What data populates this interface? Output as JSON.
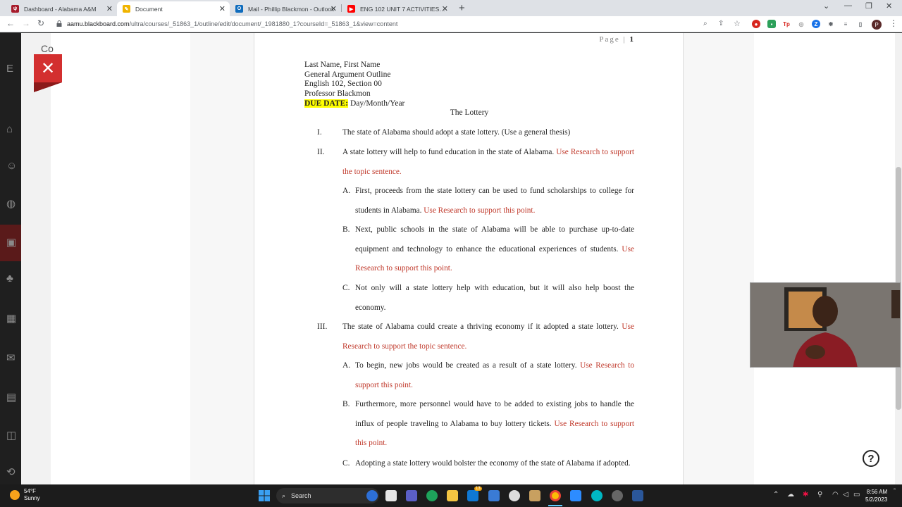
{
  "tabs": [
    {
      "label": "Dashboard - Alabama A&M",
      "color": "#a61b2b",
      "icon": "blackboard-favicon"
    },
    {
      "label": "Document",
      "color": "#f0b400",
      "icon": "document-favicon"
    },
    {
      "label": "Mail - Phillip Blackmon - Outlook",
      "color": "#0f6cbd",
      "icon": "outlook-favicon"
    },
    {
      "label": "ENG 102 UNIT 7 ACTIVITIES - Yo",
      "color": "#ff0000",
      "icon": "youtube-favicon"
    }
  ],
  "address": {
    "host": "aamu.blackboard.com",
    "path": "/ultra/courses/_51863_1/outline/edit/document/_1981880_1?courseId=_51863_1&view=content"
  },
  "profile_initial": "P",
  "side_label": "Co",
  "document": {
    "page_label": "Page",
    "page_number": "1",
    "header_lines": [
      "Last Name, First Name",
      "General Argument Outline",
      "English 102, Section 00",
      "Professor Blackmon"
    ],
    "due_label": "DUE DATE:",
    "due_value": " Day/Month/Year",
    "title": "The Lottery",
    "outline": {
      "i_num": "I.",
      "i_text": "The state of Alabama should adopt a state lottery. (Use a general thesis)",
      "ii_num": "II.",
      "ii_text": "A state lottery will help to fund education in the state of Alabama. ",
      "ii_red": "Use Research to support the topic sentence.",
      "iia_num": "A.",
      "iia_text": "First, proceeds from the state lottery can be used to fund scholarships to college for students in Alabama. ",
      "iia_red": "Use Research to support this point.",
      "iib_num": "B.",
      "iib_text": "Next, public schools in the state of Alabama will be able to purchase up-to-date equipment and technology to enhance the educational experiences of students. ",
      "iib_red": "Use Research to support this point.",
      "iic_num": "C.",
      "iic_text": "Not only will a state lottery help with education, but it will also help boost the economy.",
      "iii_num": "III.",
      "iii_text": "The state of Alabama could create a thriving economy if it adopted a state lottery. ",
      "iii_red": "Use Research to support the topic sentence.",
      "iiia_num": "A.",
      "iiia_text": "To begin, new jobs would be created as a result of a state lottery. ",
      "iiia_red": "Use Research to support this point.",
      "iiib_num": "B.",
      "iiib_text": "Furthermore, more personnel would have to be added to existing jobs to handle the influx of people traveling to Alabama to buy lottery tickets. ",
      "iiib_red": "Use Research to support this point.",
      "iiic_num": "C.",
      "iiic_text": "Adopting a state lottery would bolster the economy of the state of Alabama if adopted."
    }
  },
  "taskbar": {
    "temp": "54°F",
    "condition": "Sunny",
    "search_label": "Search",
    "mail_badge": "13",
    "time": "8:56 AM",
    "date": "5/2/2023"
  }
}
